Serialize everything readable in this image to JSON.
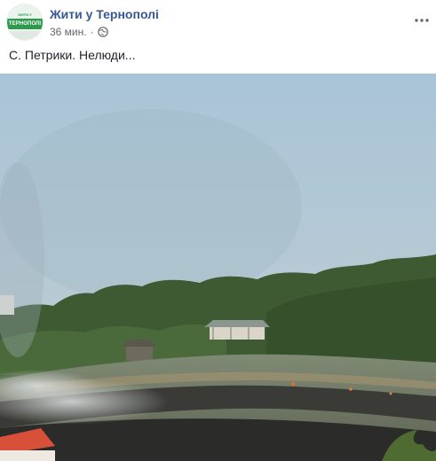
{
  "post": {
    "page_name": "Жити у Тернополі",
    "timestamp": "36 мин.",
    "separator": "·",
    "privacy_icon": "globe-icon",
    "more_icon": "more-horizontal-icon",
    "text": "С. Петрики. Нелюди..."
  },
  "avatar": {
    "top_text": "ЖИТИ У",
    "band_text": "ТЕРНОПОЛІ",
    "accent_color": "#2e9a4d"
  },
  "colors": {
    "page_name_link": "#365899",
    "meta_text": "#616770"
  }
}
